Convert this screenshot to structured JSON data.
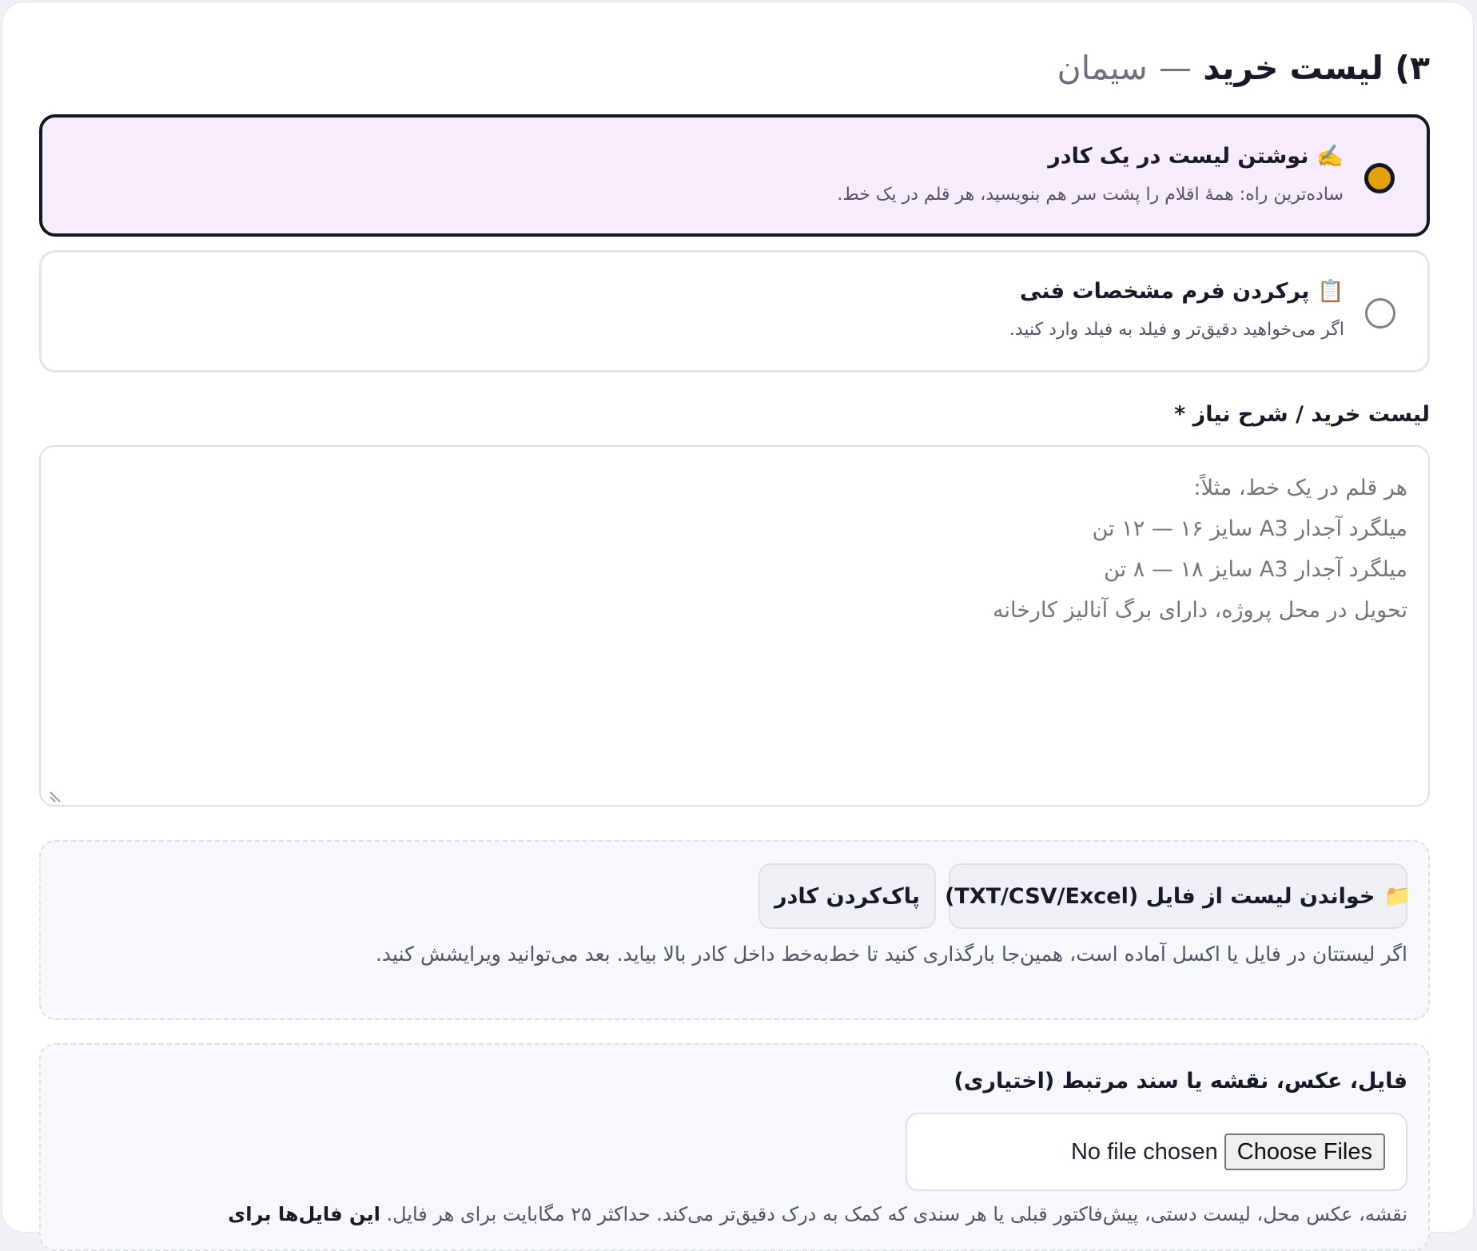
{
  "section": {
    "number": "۳)",
    "title": "لیست خرید",
    "separator": "—",
    "subtitle": "سیمان"
  },
  "options": [
    {
      "icon": "✍️",
      "title": "نوشتن لیست در یک کادر",
      "description": "ساده‌ترین راه: همهٔ اقلام را پشت سر هم بنویسید، هر قلم در یک خط.",
      "selected": true
    },
    {
      "icon": "📋",
      "title": "پرکردن فرم مشخصات فنی",
      "description": "اگر می‌خواهید دقیق‌تر و فیلد به فیلد وارد کنید.",
      "selected": false
    }
  ],
  "list_field": {
    "label": "لیست خرید / شرح نیاز *",
    "value": "",
    "placeholder": "هر قلم در یک خط، مثلاً:\nمیلگرد آجدار A3 سایز ۱۶ — ۱۲ تن\nمیلگرد آجدار A3 سایز ۱۸ — ۸ تن\nتحویل در محل پروژه، دارای برگ آنالیز کارخانه"
  },
  "upload_list": {
    "load_icon": "📁",
    "load_label": "خواندن لیست از فایل (TXT/CSV/Excel)",
    "clear_label": "پاک‌کردن کادر",
    "hint": "اگر لیستتان در فایل یا اکسل آماده است، همین‌جا بارگذاری کنید تا خط‌به‌خط داخل کادر بالا بیاید. بعد می‌توانید ویرایشش کنید."
  },
  "attachments": {
    "label": "فایل، عکس، نقشه یا سند مرتبط (اختیاری)",
    "choose_label": "Choose Files",
    "status": "No file chosen",
    "note_prefix": "نقشه، عکس محل، لیست دستی، پیش‌فاکتور قبلی یا هر سندی که کمک به درک دقیق‌تر می‌کند. حداکثر ۲۵ مگابایت برای هر فایل.",
    "note_bold": "این فایل‌ها برای"
  },
  "colors": {
    "accent": "#e3a008",
    "selected_bg": "#f6ecfb",
    "border_dark": "#13172a"
  }
}
